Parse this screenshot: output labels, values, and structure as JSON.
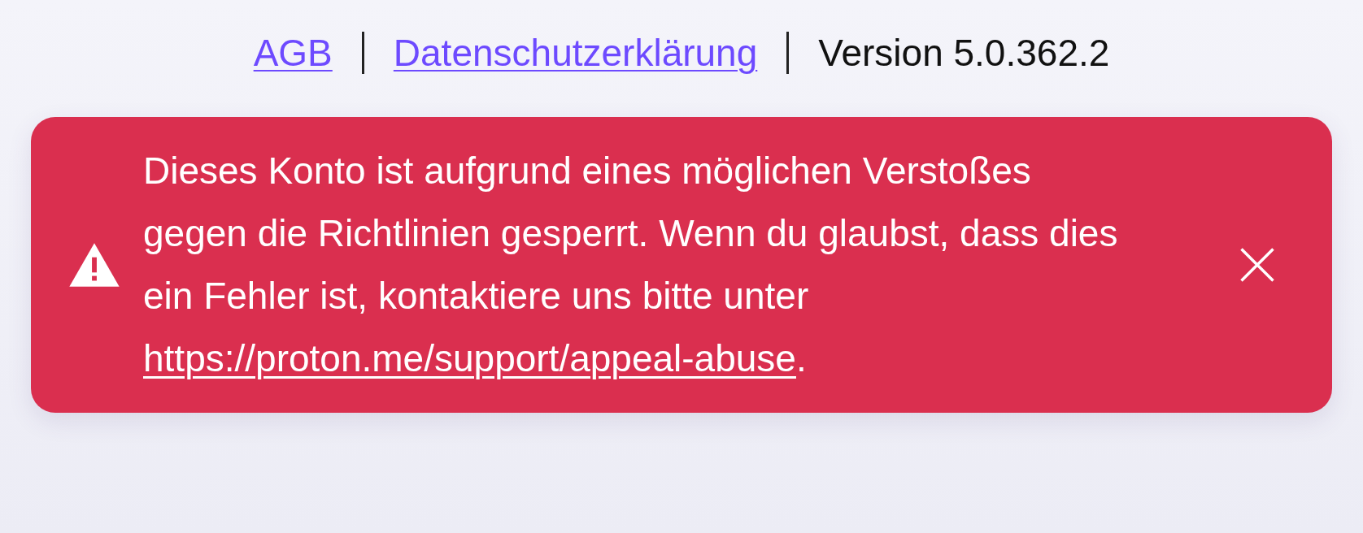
{
  "footer": {
    "links": [
      {
        "label": "AGB"
      },
      {
        "label": "Datenschutzerklärung"
      }
    ],
    "version": "Version 5.0.362.2"
  },
  "alert": {
    "before": "Dieses Konto ist aufgrund eines möglichen Verstoßes gegen die Richtlinien gesperrt. Wenn du glaubst, dass dies ein Fehler ist, kontaktiere uns bitte unter ",
    "link": "https://proton.me/support/appeal-abuse",
    "after": "."
  }
}
